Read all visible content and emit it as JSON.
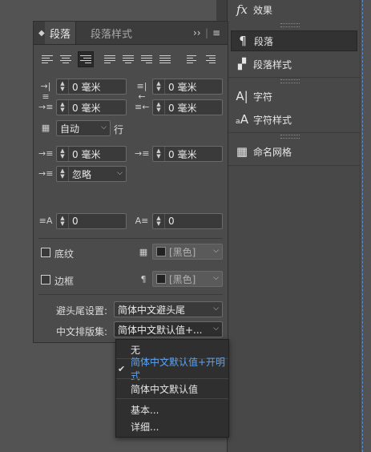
{
  "dock": {
    "effects_label": "效果",
    "paragraph_label": "段落",
    "paragraph_styles_label": "段落样式",
    "character_label": "字符",
    "character_styles_label": "字符样式",
    "named_grids_label": "命名网格"
  },
  "panel": {
    "tab_paragraph": "段落",
    "tab_paragraph_styles": "段落样式",
    "left_indent": "0 毫米",
    "right_indent": "0 毫米",
    "first_line_indent": "0 毫米",
    "last_line_indent": "0 毫米",
    "leading_value": "自动",
    "leading_unit": "行",
    "space_before": "0 毫米",
    "space_after": "0 毫米",
    "align_to_grid": "忽略",
    "drop_cap_lines": "0",
    "drop_cap_chars": "0",
    "shading_label": "底纹",
    "shading_color": "[黑色]",
    "border_label": "边框",
    "border_color": "[黑色]",
    "kinsoku_label": "避头尾设置:",
    "kinsoku_value": "简体中文避头尾",
    "mojikumi_label": "中文排版集:",
    "mojikumi_value": "简体中文默认值+..."
  },
  "menu": {
    "items": [
      "无",
      "简体中文默认值+开明式",
      "简体中文默认值",
      "基本...",
      "详细..."
    ],
    "checked_index": 1
  },
  "colors": {
    "accent": "#5ea3f2",
    "guide": "#5a8fd6"
  }
}
